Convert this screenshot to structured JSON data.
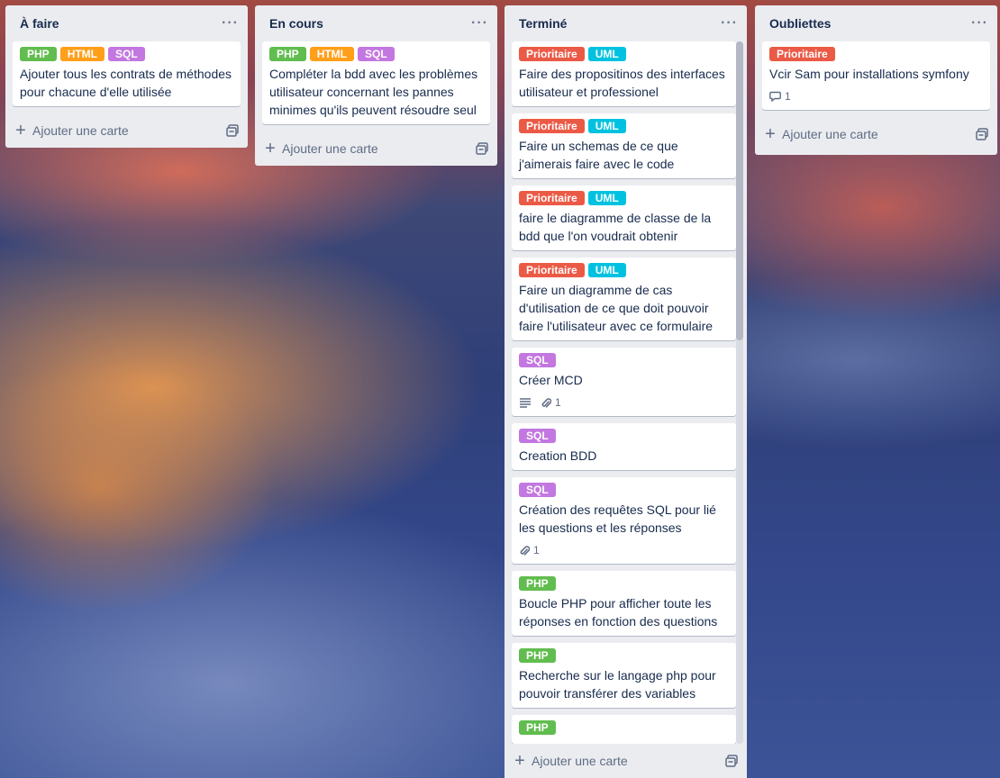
{
  "colors": {
    "green": "#61bd4f",
    "orange": "#ff9f1a",
    "purple": "#c377e0",
    "red": "#eb5a46",
    "sky": "#00c2e0"
  },
  "lists": [
    {
      "title": "À faire",
      "add_label": "Ajouter une carte",
      "cards": [
        {
          "labels": [
            "PHP",
            "HTML",
            "SQL"
          ],
          "title": "Ajouter tous les contrats de méthodes pour chacune d'elle utilisée"
        }
      ]
    },
    {
      "title": "En cours",
      "add_label": "Ajouter une carte",
      "cards": [
        {
          "labels": [
            "PHP",
            "HTML",
            "SQL"
          ],
          "title": "Compléter la bdd avec les problèmes utilisateur concernant les pannes minimes qu'ils peuvent résoudre seul"
        }
      ]
    },
    {
      "title": "Terminé",
      "add_label": "Ajouter une carte",
      "cards": [
        {
          "labels": [
            "Prioritaire",
            "UML"
          ],
          "title": "Faire des propositinos des interfaces utilisateur et professionel"
        },
        {
          "labels": [
            "Prioritaire",
            "UML"
          ],
          "title": "Faire un schemas de ce que j'aimerais faire avec le code"
        },
        {
          "labels": [
            "Prioritaire",
            "UML"
          ],
          "title": "faire le diagramme de classe de la bdd que l'on voudrait obtenir"
        },
        {
          "labels": [
            "Prioritaire",
            "UML"
          ],
          "title": "Faire un diagramme de cas d'utilisation de ce que doit pouvoir faire l'utilisateur avec ce formulaire"
        },
        {
          "labels": [
            "SQL"
          ],
          "title": "Créer MCD",
          "attachments": "1"
        },
        {
          "labels": [
            "SQL"
          ],
          "title": "Creation BDD"
        },
        {
          "labels": [
            "SQL"
          ],
          "title": "Création des requêtes SQL pour lié les questions et les réponses",
          "attachments": "1"
        },
        {
          "labels": [
            "PHP"
          ],
          "title": "Boucle PHP pour afficher toute les réponses en fonction des questions"
        },
        {
          "labels": [
            "PHP"
          ],
          "title": "Recherche sur le langage php pour pouvoir transférer des variables"
        },
        {
          "labels": [
            "PHP"
          ],
          "title": ""
        }
      ]
    },
    {
      "title": "Oubliettes",
      "add_label": "Ajouter une carte",
      "cards": [
        {
          "labels": [
            "Prioritaire"
          ],
          "title": "Vcir Sam pour installations symfony",
          "comments": "1"
        }
      ]
    }
  ]
}
